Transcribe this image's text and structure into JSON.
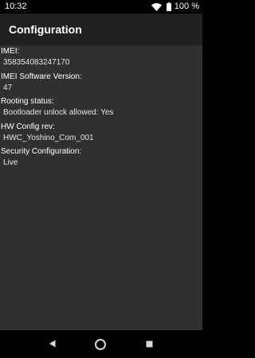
{
  "status_bar": {
    "time": "10:32",
    "battery_percent": "100 %",
    "icons": [
      "wifi-icon",
      "battery-icon"
    ]
  },
  "app_bar": {
    "title": "Configuration"
  },
  "info": [
    {
      "label": "IMEI:",
      "value": "358354083247170"
    },
    {
      "label": "IMEI Software Version:",
      "value": "47"
    },
    {
      "label": "Rooting status:",
      "value": "Bootloader unlock allowed: Yes"
    },
    {
      "label": "HW Config rev:",
      "value": "HWC_Yoshino_Com_001"
    },
    {
      "label": "Security Configuration:",
      "value": "Live"
    }
  ],
  "nav_bar": {
    "icons": [
      "back-icon",
      "home-icon",
      "recents-icon"
    ]
  },
  "colors": {
    "app_bar": "#212121",
    "content_bg": "#303030",
    "status_bar": "#000000",
    "nav_bar": "#000000"
  }
}
